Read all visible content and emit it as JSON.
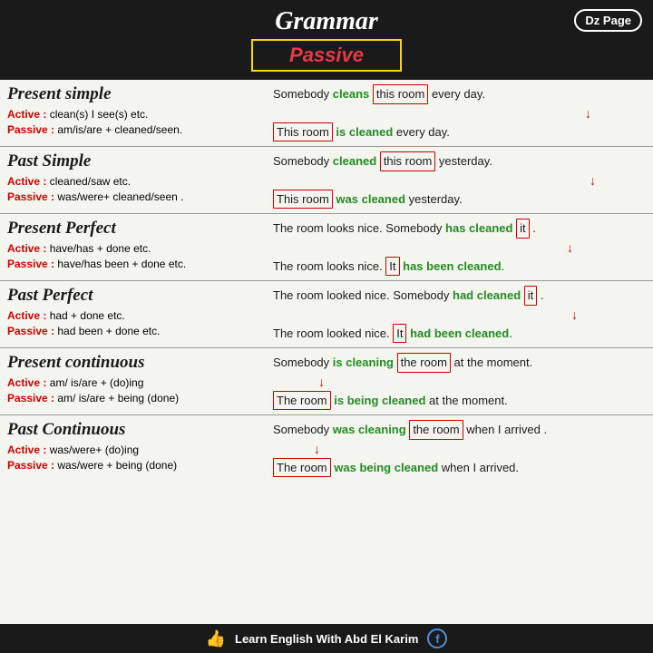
{
  "header": {
    "title": "Grammar",
    "passive_label": "Passive",
    "dz_page": "Dz Page"
  },
  "sections": [
    {
      "id": "present-simple",
      "title": "Present simple",
      "active_rule": "Active : clean(s) I see(s) etc.",
      "passive_rule": "Passive : am/is/are + cleaned/seen.",
      "example_top": [
        "Somebody ",
        "cleans",
        " ",
        "this room",
        " every day."
      ],
      "example_bottom": [
        "",
        "This room",
        " ",
        "is cleaned",
        " every day."
      ]
    },
    {
      "id": "past-simple",
      "title": "Past Simple",
      "active_rule": "Active : cleaned/saw etc.",
      "passive_rule": "Passive : was/were+ cleaned/seen .",
      "example_top": [
        "Somebody ",
        "cleaned",
        " ",
        "this room",
        " yesterday."
      ],
      "example_bottom": [
        "",
        "This room",
        " ",
        "was cleaned",
        " yesterday."
      ]
    },
    {
      "id": "present-perfect",
      "title": "Present Perfect",
      "active_rule": "Active :  have/has + done etc.",
      "passive_rule": "Passive : have/has been + done etc.",
      "example_top": [
        "The room looks nice. Somebody ",
        "has cleaned",
        " ",
        "it",
        "."
      ],
      "example_bottom": [
        "The room looks nice. ",
        "It",
        " ",
        "has been cleaned",
        "."
      ]
    },
    {
      "id": "past-perfect",
      "title": "Past Perfect",
      "active_rule": "Active : had + done etc.",
      "passive_rule": "Passive : had been + done etc.",
      "example_top": [
        "The room looked nice. Somebody ",
        "had cleaned",
        " ",
        "it",
        "."
      ],
      "example_bottom": [
        "The room looked nice. ",
        "It",
        " ",
        "had been cleaned",
        "."
      ]
    },
    {
      "id": "present-continuous",
      "title": "Present continuous",
      "active_rule": "Active : am/ is/are + (do)ing",
      "passive_rule": "Passive : am/ is/are + being (done)",
      "example_top": [
        "Somebody ",
        "is cleaning",
        " ",
        "the room",
        " at the moment."
      ],
      "example_bottom": [
        "",
        "The room",
        " ",
        "is being cleaned",
        " at the moment."
      ]
    },
    {
      "id": "past-continuous",
      "title": "Past Continuous",
      "active_rule": "Active : was/were+ (do)ing",
      "passive_rule": "Passive : was/were + being (done)",
      "example_top": [
        "Somebody ",
        "was cleaning",
        " ",
        "the room",
        " when I arrived ."
      ],
      "example_bottom": [
        "",
        "The room",
        " ",
        "was being cleaned",
        " when I arrived."
      ]
    }
  ],
  "footer": {
    "text": "Learn English With Abd El Karim"
  }
}
